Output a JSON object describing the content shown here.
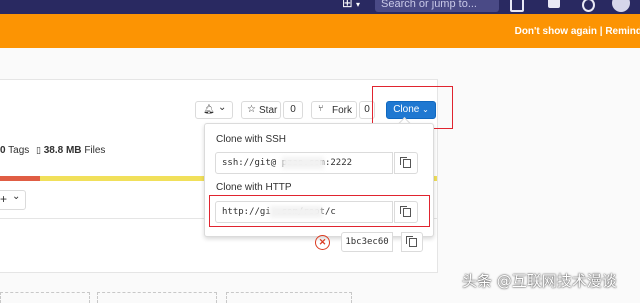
{
  "navbar": {
    "plus_icon": "plus-square-icon",
    "search_placeholder": "Search or jump to...",
    "icons": [
      "issues-icon",
      "merge-request-icon",
      "todo-icon",
      "avatar"
    ]
  },
  "banner": {
    "text": "Don't show again | Remind"
  },
  "repo_actions": {
    "notification_caret": "⌄",
    "star_label": "Star",
    "star_count": "0",
    "fork_label": "Fork",
    "fork_count": "0",
    "clone_label": "Clone"
  },
  "stats": {
    "tags_count": "0",
    "tags_label": "Tags",
    "size_value": "38.8 MB",
    "size_label": "Files"
  },
  "branch_bar": {
    "add_symbol": "+",
    "caret": "⌄"
  },
  "clone_dropdown": {
    "ssh_title": "Clone with SSH",
    "ssh_url": "ssh://git@             pzao.com:2222",
    "http_title": "Clone with HTTP",
    "http_url": "http://gi             .com/root/c"
  },
  "commit": {
    "sha": "1bc3ec60",
    "status_icon": "failed-status-icon"
  },
  "watermark": {
    "text": "头条 @互联网技术漫谈"
  },
  "colors": {
    "navbar": "#292961",
    "banner": "#fc9403",
    "clone_button": "#1f78d1",
    "highlight": "#e0242f",
    "language_bar": [
      "#e05d44",
      "#f1e05a"
    ]
  }
}
